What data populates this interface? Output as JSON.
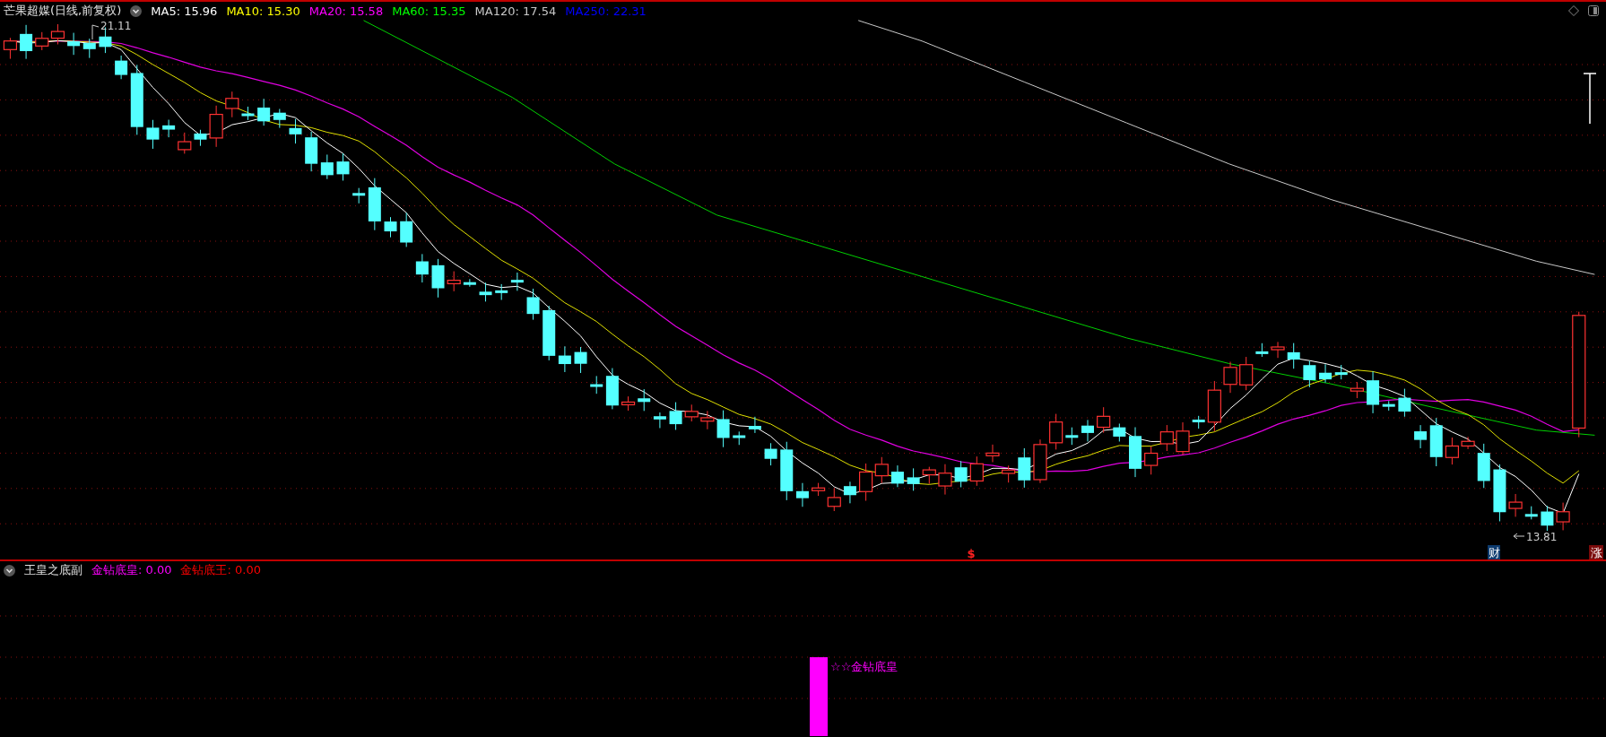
{
  "header": {
    "title": "芒果超媒(日线,前复权)",
    "indicators": [
      {
        "label": "MA5: 15.96",
        "color": "#ffffff"
      },
      {
        "label": "MA10: 15.30",
        "color": "#ffff00"
      },
      {
        "label": "MA20: 15.58",
        "color": "#ff00ff"
      },
      {
        "label": "MA60: 15.35",
        "color": "#00ff00"
      },
      {
        "label": "MA120: 17.54",
        "color": "#c8c8c8"
      },
      {
        "label": "MA250: 22.31",
        "color": "#0000ff"
      }
    ]
  },
  "main_chart": {
    "high_label": "21.11",
    "low_label": "13.81",
    "markers": [
      {
        "text": "$",
        "kind": "signal"
      },
      {
        "text": "财",
        "kind": "finance"
      },
      {
        "text": "涨",
        "kind": "limit-up"
      }
    ]
  },
  "sub_panel": {
    "title": "王皇之底副",
    "values": [
      {
        "label": "金钻底皇: 0.00",
        "color": "#ff00ff"
      },
      {
        "label": "金钻底王: 0.00",
        "color": "#ff0000"
      }
    ],
    "signal_label": "☆☆金钻底皇"
  }
}
